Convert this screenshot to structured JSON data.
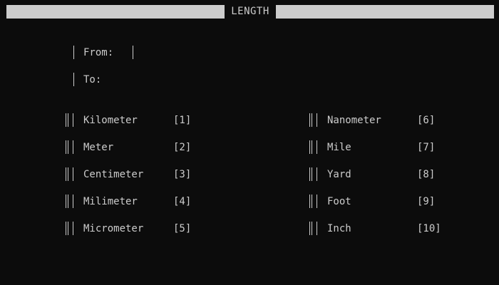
{
  "title": "LENGTH",
  "from_label": "From:",
  "to_label": "To:",
  "units_left": [
    {
      "name": "Kilometer",
      "key": "[1]"
    },
    {
      "name": "Meter",
      "key": "[2]"
    },
    {
      "name": "Centimeter",
      "key": "[3]"
    },
    {
      "name": "Milimeter",
      "key": "[4]"
    },
    {
      "name": "Micrometer",
      "key": "[5]"
    }
  ],
  "units_right": [
    {
      "name": "Nanometer",
      "key": "[6]"
    },
    {
      "name": "Mile",
      "key": "[7]"
    },
    {
      "name": "Yard",
      "key": "[8]"
    },
    {
      "name": "Foot",
      "key": "[9]"
    },
    {
      "name": "Inch",
      "key": "[10]"
    }
  ]
}
